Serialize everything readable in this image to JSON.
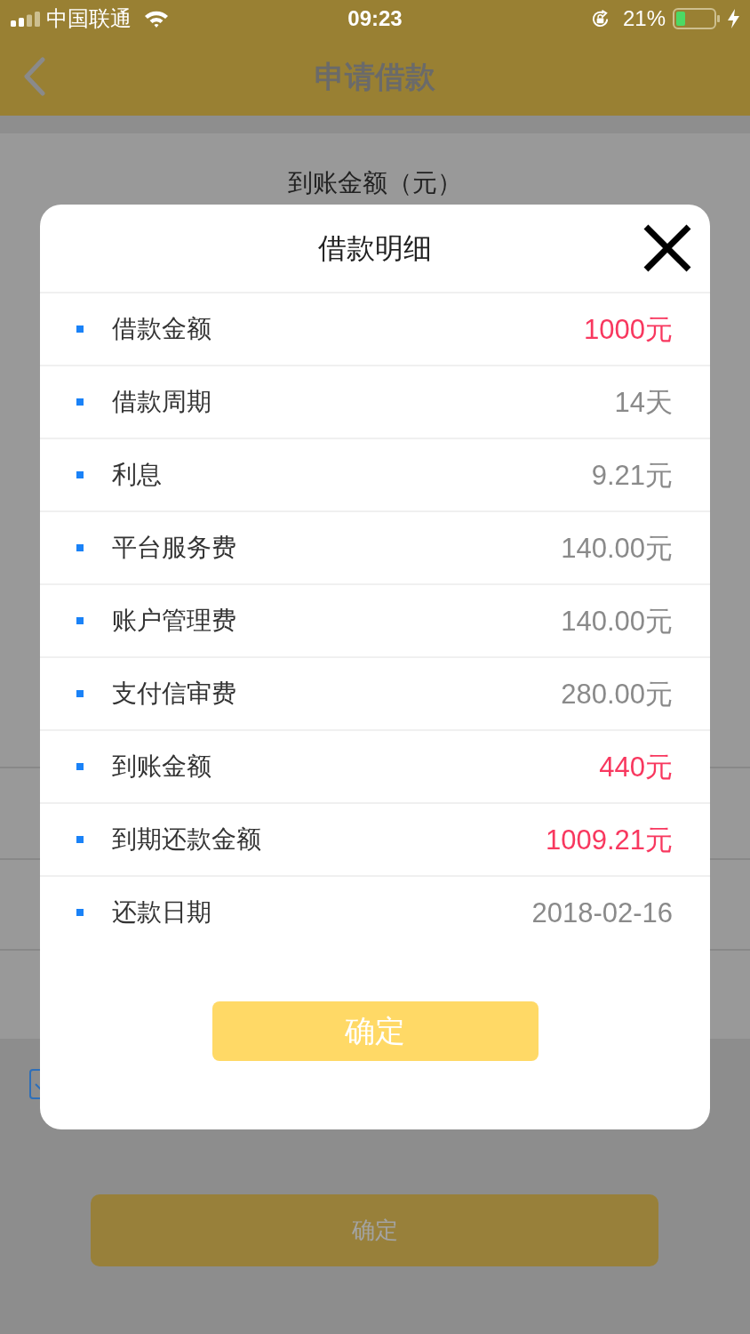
{
  "status_bar": {
    "carrier": "中国联通",
    "time": "09:23",
    "battery": "21%"
  },
  "nav": {
    "title": "申请借款"
  },
  "background": {
    "amount_label": "到账金额（元）",
    "agree_checkbox": {
      "checked": true
    },
    "submit_button": "确定"
  },
  "dialog": {
    "title": "借款明细",
    "rows": [
      {
        "label": "借款金额",
        "value": "1000元",
        "color": "#f8385f"
      },
      {
        "label": "借款周期",
        "value": "14天",
        "color": "#8a8a8a"
      },
      {
        "label": "利息",
        "value": "9.21元",
        "color": "#8a8a8a"
      },
      {
        "label": "平台服务费",
        "value": "140.00元",
        "color": "#8a8a8a"
      },
      {
        "label": "账户管理费",
        "value": "140.00元",
        "color": "#8a8a8a"
      },
      {
        "label": "支付信审费",
        "value": "280.00元",
        "color": "#8a8a8a"
      },
      {
        "label": "到账金额",
        "value": "440元",
        "color": "#f8385f"
      },
      {
        "label": "到期还款金额",
        "value": "1009.21元",
        "color": "#f8385f"
      },
      {
        "label": "还款日期",
        "value": "2018-02-16",
        "color": "#8a8a8a"
      }
    ],
    "confirm_button": "确定"
  }
}
